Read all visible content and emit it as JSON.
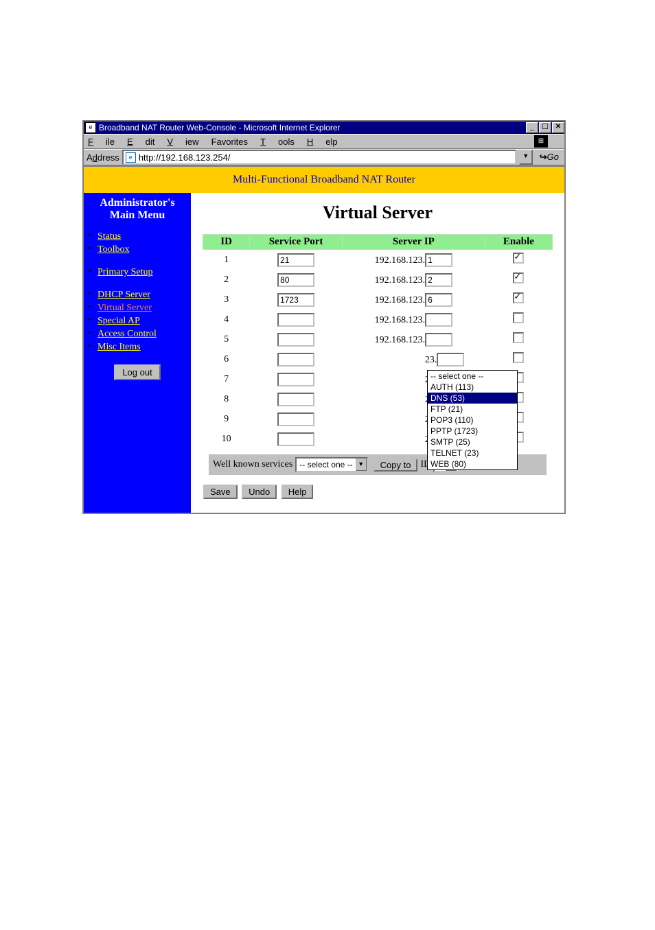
{
  "window": {
    "title": "Broadband NAT Router Web-Console - Microsoft Internet Explorer"
  },
  "menu": {
    "file": "File",
    "edit": "Edit",
    "view": "View",
    "favorites": "Favorites",
    "tools": "Tools",
    "help": "Help"
  },
  "address": {
    "label": "Address",
    "url": "http://192.168.123.254/",
    "go": "Go"
  },
  "banner": "Multi-Functional Broadband NAT Router",
  "sidebar": {
    "title1": "Administrator's",
    "title2": "Main Menu",
    "items": [
      "Status",
      "Toolbox",
      "Primary Setup",
      "DHCP Server",
      "Virtual Server",
      "Special AP",
      "Access Control",
      "Misc Items"
    ],
    "logout": "Log out"
  },
  "main": {
    "title": "Virtual Server",
    "headers": {
      "id": "ID",
      "port": "Service Port",
      "ip": "Server IP",
      "enable": "Enable"
    },
    "ip_prefix": "192.168.123.",
    "rows": [
      {
        "id": "1",
        "port": "21",
        "octet": "1",
        "checked": true
      },
      {
        "id": "2",
        "port": "80",
        "octet": "2",
        "checked": true
      },
      {
        "id": "3",
        "port": "1723",
        "octet": "6",
        "checked": true
      },
      {
        "id": "4",
        "port": "",
        "octet": "",
        "checked": false
      },
      {
        "id": "5",
        "port": "",
        "octet": "",
        "checked": false
      },
      {
        "id": "6",
        "port": "",
        "octet": "",
        "checked": false
      },
      {
        "id": "7",
        "port": "",
        "octet": "",
        "checked": false
      },
      {
        "id": "8",
        "port": "",
        "octet": "",
        "checked": false
      },
      {
        "id": "9",
        "port": "",
        "octet": "",
        "checked": false
      },
      {
        "id": "10",
        "port": "",
        "octet": "",
        "checked": false
      }
    ],
    "wellknown_label": "Well known services",
    "wellknown_selected": "-- select one --",
    "wellknown_options": [
      "-- select one --",
      "AUTH (113)",
      "DNS (53)",
      "FTP (21)",
      "POP3 (110)",
      "PPTP (1723)",
      "SMTP (25)",
      "TELNET (23)",
      "WEB (80)"
    ],
    "wellknown_highlight": "DNS (53)",
    "copy_to": "Copy to",
    "id_label": "ID",
    "id_sel": "--",
    "buttons": {
      "save": "Save",
      "undo": "Undo",
      "help": "Help"
    },
    "ip_tail_23": "23."
  }
}
